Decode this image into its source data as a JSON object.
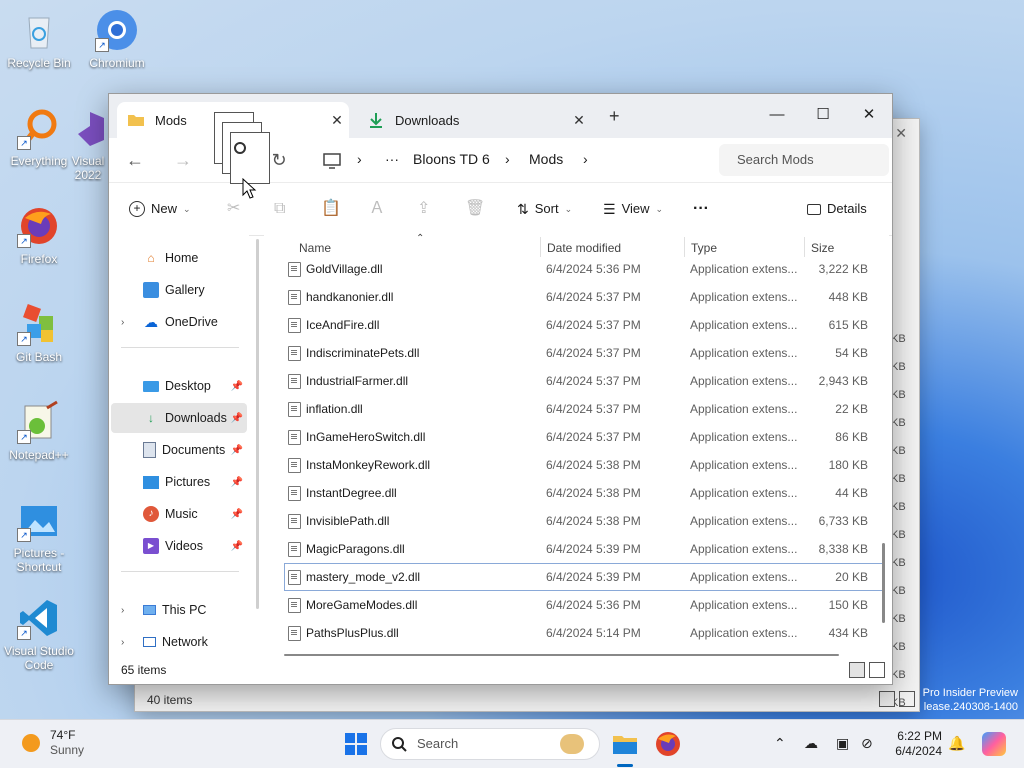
{
  "desktop": {
    "icons": [
      {
        "label": "Recycle Bin"
      },
      {
        "label": "Chromium"
      },
      {
        "label": "Everything"
      },
      {
        "label": "Visual 2022"
      },
      {
        "label": "Firefox"
      },
      {
        "label": "Git Bash"
      },
      {
        "label": "Notepad++"
      },
      {
        "label": "Pictures - Shortcut"
      },
      {
        "label": "Visual Studio Code"
      }
    ],
    "watermark_line1": "Pro Insider Preview",
    "watermark_line2": "lease.240308-1400"
  },
  "bg_window": {
    "status": "40 items",
    "size_stub": "KB"
  },
  "window": {
    "tabs": [
      {
        "label": "Mods"
      },
      {
        "label": "Downloads"
      }
    ],
    "new_tab_symbol": "+",
    "breadcrumb": [
      "Bloons TD 6",
      "Mods"
    ],
    "breadcrumb_more": "···",
    "search_placeholder": "Search Mods",
    "commands": {
      "new": "New",
      "sort": "Sort",
      "view": "View",
      "more": "···",
      "details": "Details"
    },
    "sidebar": {
      "home": "Home",
      "gallery": "Gallery",
      "onedrive": "OneDrive",
      "desktop": "Desktop",
      "downloads": "Downloads",
      "documents": "Documents",
      "pictures": "Pictures",
      "music": "Music",
      "videos": "Videos",
      "thispc": "This PC",
      "network": "Network"
    },
    "columns": {
      "name": "Name",
      "date": "Date modified",
      "type": "Type",
      "size": "Size"
    },
    "files": [
      {
        "name": "GoldVillage.dll",
        "date": "6/4/2024 5:36 PM",
        "type": "Application extens...",
        "size": "3,222 KB"
      },
      {
        "name": "handkanonier.dll",
        "date": "6/4/2024 5:37 PM",
        "type": "Application extens...",
        "size": "448 KB"
      },
      {
        "name": "IceAndFire.dll",
        "date": "6/4/2024 5:37 PM",
        "type": "Application extens...",
        "size": "615 KB"
      },
      {
        "name": "IndiscriminatePets.dll",
        "date": "6/4/2024 5:37 PM",
        "type": "Application extens...",
        "size": "54 KB"
      },
      {
        "name": "IndustrialFarmer.dll",
        "date": "6/4/2024 5:37 PM",
        "type": "Application extens...",
        "size": "2,943 KB"
      },
      {
        "name": "inflation.dll",
        "date": "6/4/2024 5:37 PM",
        "type": "Application extens...",
        "size": "22 KB"
      },
      {
        "name": "InGameHeroSwitch.dll",
        "date": "6/4/2024 5:37 PM",
        "type": "Application extens...",
        "size": "86 KB"
      },
      {
        "name": "InstaMonkeyRework.dll",
        "date": "6/4/2024 5:38 PM",
        "type": "Application extens...",
        "size": "180 KB"
      },
      {
        "name": "InstantDegree.dll",
        "date": "6/4/2024 5:38 PM",
        "type": "Application extens...",
        "size": "44 KB"
      },
      {
        "name": "InvisiblePath.dll",
        "date": "6/4/2024 5:38 PM",
        "type": "Application extens...",
        "size": "6,733 KB"
      },
      {
        "name": "MagicParagons.dll",
        "date": "6/4/2024 5:39 PM",
        "type": "Application extens...",
        "size": "8,338 KB"
      },
      {
        "name": "mastery_mode_v2.dll",
        "date": "6/4/2024 5:39 PM",
        "type": "Application extens...",
        "size": "20 KB"
      },
      {
        "name": "MoreGameModes.dll",
        "date": "6/4/2024 5:36 PM",
        "type": "Application extens...",
        "size": "150 KB"
      },
      {
        "name": "PathsPlusPlus.dll",
        "date": "6/4/2024 5:14 PM",
        "type": "Application extens...",
        "size": "434 KB"
      }
    ],
    "status": "65 items"
  },
  "taskbar": {
    "weather_temp": "74°F",
    "weather_cond": "Sunny",
    "search_placeholder": "Search",
    "time": "6:22 PM",
    "date": "6/4/2024"
  },
  "colors": {
    "accent": "#0067c0",
    "folder": "#f2c14e",
    "download_green": "#1e9e55"
  }
}
